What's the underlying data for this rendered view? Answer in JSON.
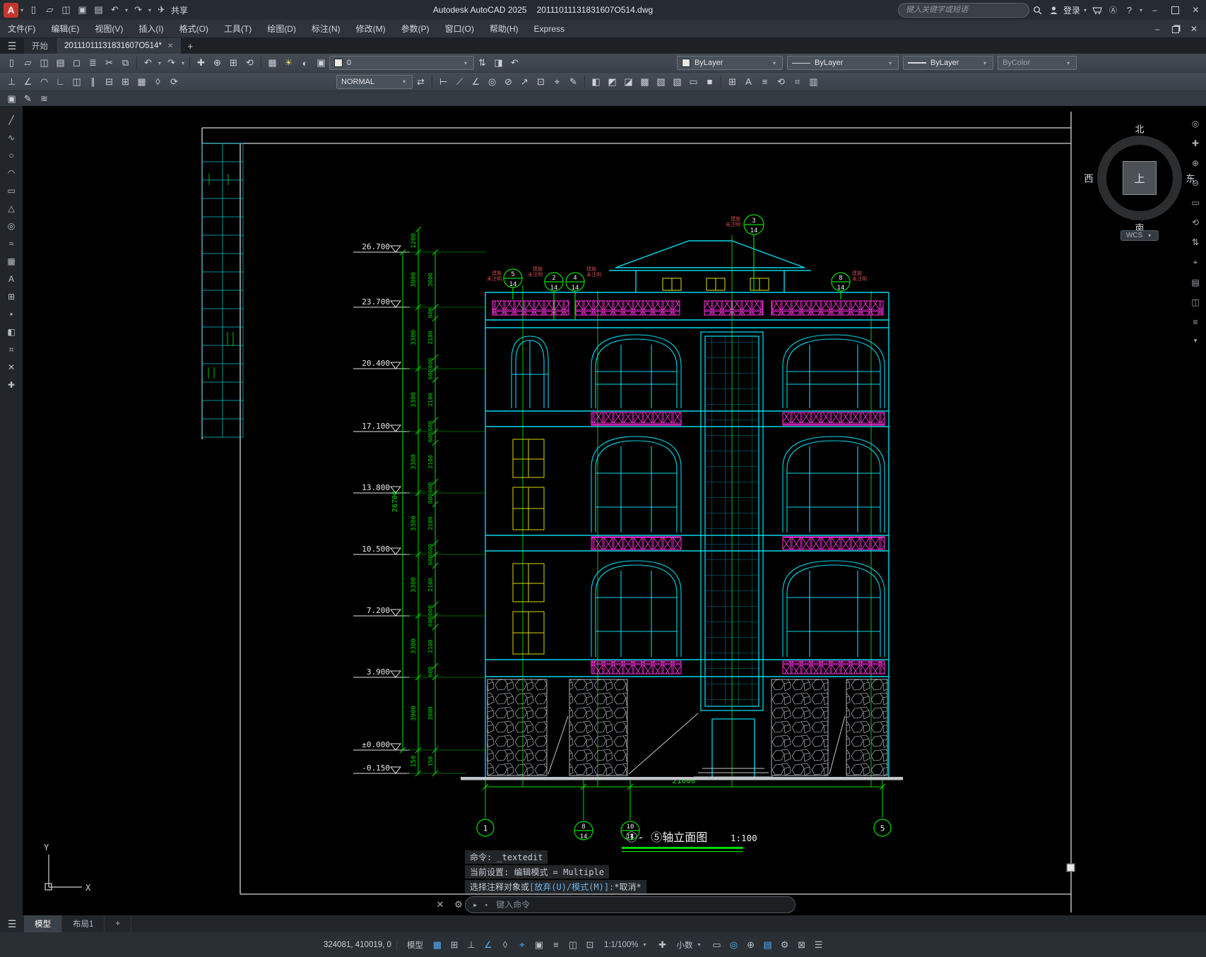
{
  "titlebar": {
    "logo": "A",
    "share": "共享",
    "app_title": "Autodesk AutoCAD 2025",
    "doc_title": "20111011131831607O514.dwg",
    "search_placeholder": "键入关键字或短语",
    "login": "登录"
  },
  "menubar": {
    "items": [
      "文件(F)",
      "编辑(E)",
      "视图(V)",
      "插入(I)",
      "格式(O)",
      "工具(T)",
      "绘图(D)",
      "标注(N)",
      "修改(M)",
      "参数(P)",
      "窗口(O)",
      "帮助(H)",
      "Express"
    ]
  },
  "tabbar": {
    "start": "开始",
    "doc": "20111011131831607O514*"
  },
  "toolbars": {
    "layer": "0",
    "color": "ByLayer",
    "linetype": "ByLayer",
    "lineweight": "ByLayer",
    "plotstyle": "ByColor",
    "textstyle": "NORMAL"
  },
  "drawing": {
    "levels": [
      "26.700",
      "23.700",
      "20.400",
      "17.100",
      "13.800",
      "10.500",
      "7.200",
      "3.900",
      "±0.000",
      "-0.150"
    ],
    "dim_total": "26700",
    "chainA": [
      "1200",
      "3000",
      "3300",
      "3300",
      "3300",
      "3300",
      "3300",
      "3300",
      "3900",
      "150"
    ],
    "chainB": [
      "3000",
      "600",
      "2100",
      "600",
      "600",
      "2100",
      "600",
      "600",
      "2100",
      "600",
      "600",
      "2100",
      "600",
      "600",
      "2100",
      "600",
      "600",
      "2100",
      "600",
      "3900",
      "150"
    ],
    "dim_bottom": "21000",
    "title": "①- ⑤轴立面图",
    "scale": "1:100",
    "ref": {
      "l1": "建施",
      "l2": "未注明"
    },
    "bubbles": {
      "high": {
        "n": "3",
        "d": "14"
      },
      "t1": {
        "n": "5",
        "d": "14"
      },
      "t2": {
        "n": "2",
        "d": "14"
      },
      "t3": {
        "n": "4",
        "d": "14"
      },
      "t4": {
        "n": "8",
        "d": "14"
      },
      "b1": {
        "n": "8",
        "d": "14"
      },
      "b2": {
        "n": "10",
        "d": "14"
      },
      "left": "1",
      "right": "5"
    },
    "compass": {
      "n": "北",
      "s": "南",
      "e": "东",
      "w": "西",
      "up": "上",
      "wcs": "WCS"
    },
    "command": {
      "line1": "命令: _textedit",
      "line2": "当前设置: 编辑模式 = Multiple",
      "line3_pre": "选择注释对象或",
      "line3_opt": "[放弃(U)/模式(M)]:",
      "line3_post": "*取消*",
      "placeholder": "键入命令"
    },
    "ucs": {
      "x": "X",
      "y": "Y"
    }
  },
  "layout_tabs": {
    "model": "模型",
    "layout1": "布局1",
    "add": "+"
  },
  "statusbar": {
    "coords": "324081, 410019, 0",
    "model": "模型",
    "scale": "1:1/100%",
    "units": "小数"
  }
}
